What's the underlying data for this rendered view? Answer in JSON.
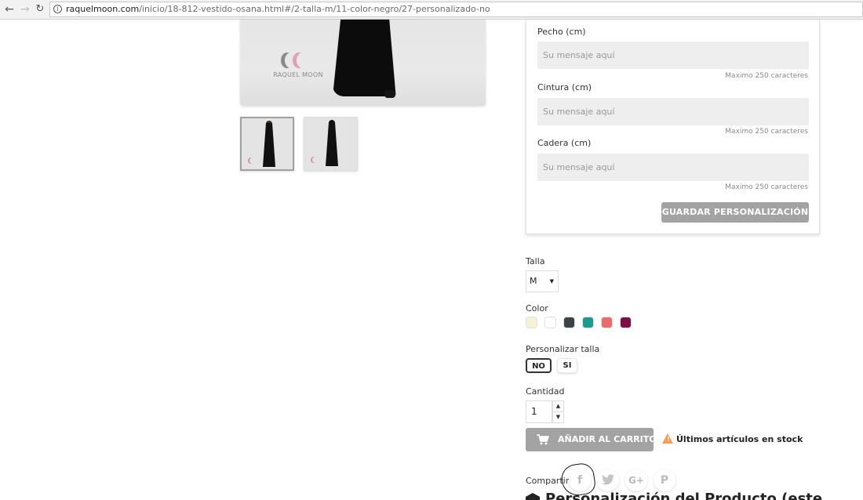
{
  "browser": {
    "url_domain": "raquelmoon.com",
    "url_path": "/inicio/18-812-vestido-osana.html#/2-talla-m/11-color-negro/27-personalizado-no"
  },
  "gallery": {
    "logo_text": "RAQUEL MOON"
  },
  "customization": {
    "fields": [
      {
        "label": "Pecho (cm)",
        "placeholder": "Su mensaje aquí",
        "hint": "Maximo 250 caracteres"
      },
      {
        "label": "Cintura (cm)",
        "placeholder": "Su mensaje aquí",
        "hint": "Maximo 250 caracteres"
      },
      {
        "label": "Cadera (cm)",
        "placeholder": "Su mensaje aquí",
        "hint": "Maximo 250 caracteres"
      }
    ],
    "save_label": "GUARDAR PERSONALIZACIÓN"
  },
  "variants": {
    "size_label": "Talla",
    "size_value": "M",
    "color_label": "Color",
    "colors": [
      "#f5f3d6",
      "#ffffff",
      "#3d4148",
      "#1e9b8c",
      "#ea6b6b",
      "#7a1246"
    ],
    "customize_size_label": "Personalizar talla",
    "customize_options": [
      "NO",
      "SI"
    ]
  },
  "purchase": {
    "quantity_label": "Cantidad",
    "quantity_value": "1",
    "add_to_cart_label": "AÑADIR AL CARRITO",
    "stock_warning": "Últimos artículos en stock"
  },
  "share": {
    "label": "Compartir",
    "networks": [
      "facebook-icon",
      "twitter-icon",
      "google-plus-icon",
      "pinterest-icon"
    ]
  },
  "section_heading": "Personalización del Producto (este"
}
